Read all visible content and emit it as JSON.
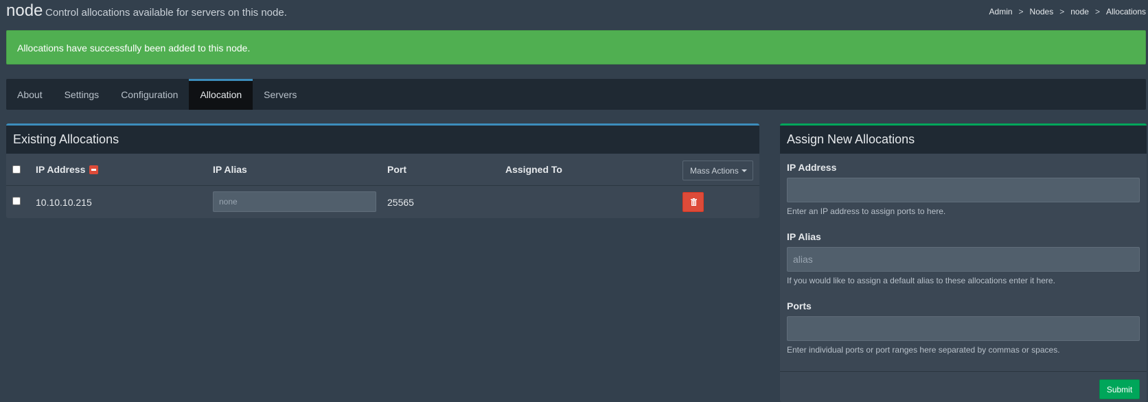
{
  "header": {
    "title": "node",
    "subtitle": "Control allocations available for servers on this node.",
    "breadcrumb": [
      "Admin",
      "Nodes",
      "node",
      "Allocations"
    ],
    "breadcrumb_sep": ">"
  },
  "alert": {
    "message": "Allocations have successfully been added to this node.",
    "color": "#50af51"
  },
  "tabs": [
    {
      "label": "About",
      "active": false
    },
    {
      "label": "Settings",
      "active": false
    },
    {
      "label": "Configuration",
      "active": false
    },
    {
      "label": "Allocation",
      "active": true
    },
    {
      "label": "Servers",
      "active": false
    }
  ],
  "existing": {
    "title": "Existing Allocations",
    "columns": {
      "ip": "IP Address",
      "alias": "IP Alias",
      "port": "Port",
      "assigned": "Assigned To"
    },
    "mass_actions_label": "Mass Actions",
    "rows": [
      {
        "ip": "10.10.10.215",
        "alias_placeholder": "none",
        "port": "25565",
        "assigned": ""
      }
    ]
  },
  "assign": {
    "title": "Assign New Allocations",
    "ip_label": "IP Address",
    "ip_value": "",
    "ip_help": "Enter an IP address to assign ports to here.",
    "alias_label": "IP Alias",
    "alias_placeholder": "alias",
    "alias_help": "If you would like to assign a default alias to these allocations enter it here.",
    "ports_label": "Ports",
    "ports_value": "",
    "ports_help": "Enter individual ports or port ranges here separated by commas or spaces.",
    "submit_label": "Submit"
  },
  "colors": {
    "accent_blue": "#3c8dbc",
    "accent_green": "#00a65a",
    "danger": "#dd4b39"
  }
}
